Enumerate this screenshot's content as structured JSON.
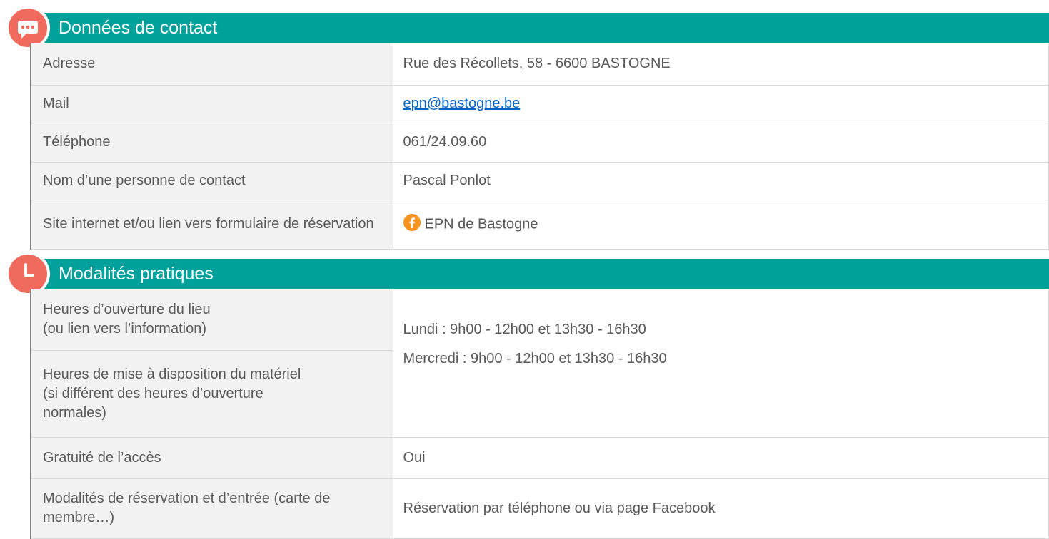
{
  "contact": {
    "title": "Données de contact",
    "rows": [
      {
        "label": "Adresse",
        "value": "Rue des Récollets, 58 - 6600 BASTOGNE"
      },
      {
        "label": "Mail",
        "value": "epn@bastogne.be"
      },
      {
        "label": "Téléphone",
        "value": "061/24.09.60"
      },
      {
        "label": "Nom d’une personne de contact",
        "value": "Pascal Ponlot"
      },
      {
        "label": "Site internet et/ou lien vers formulaire de réservation",
        "value": "EPN de Bastogne"
      }
    ]
  },
  "practical": {
    "title": "Modalités pratiques",
    "opening_label": "Heures d’ouverture du lieu\n(ou lien vers l’information)",
    "material_label": "Heures de mise à disposition du matériel (si différent des heures d’ouverture normales)",
    "hours": [
      "Lundi : 9h00 - 12h00 et 13h30 - 16h30",
      "Mercredi : 9h00 - 12h00 et 13h30 - 16h30"
    ],
    "free_label": "Gratuité de l’accès",
    "free_value": "Oui",
    "reservation_label": "Modalités de réservation et d’entrée (carte de membre…)",
    "reservation_value": "Réservation par téléphone ou via page Facebook"
  },
  "colors": {
    "header_bg": "#00a19a",
    "badge": "#f06b5d",
    "label_bg": "#f2f2f2",
    "link": "#0563c1",
    "facebook": "#f7941d"
  },
  "icons": {
    "contact": "chat-bubble-icon",
    "practical": "clock-icon",
    "website": "facebook-icon"
  }
}
